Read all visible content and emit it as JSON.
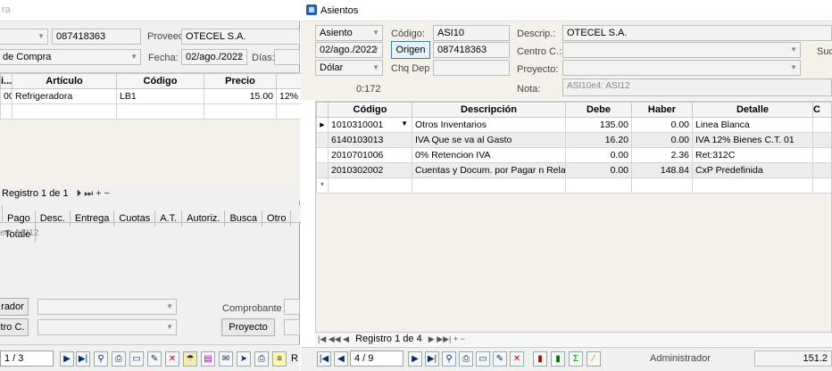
{
  "left": {
    "title_partial": "ra",
    "provider_ruc": "087418363",
    "proveedor_label": "Proveed.",
    "proveedor_value": "OTECEL S.A.",
    "doc_type": "de Compra",
    "fecha_label": "Fecha:",
    "fecha_value": "02/ago./2022",
    "dias_label": "Días:",
    "grid": {
      "headers": [
        "i...",
        "Artículo",
        "Código",
        "Precio",
        ""
      ],
      "rows": [
        [
          "00",
          "Refrigeradora",
          "LB1",
          "15.00",
          "12%"
        ]
      ]
    },
    "registro": "Registro 1 de 1",
    "tabs": [
      "Pago",
      "Desc.",
      "Entrega",
      "Cuotas",
      "A.T.",
      "Autoriz.",
      "Busca",
      "Otro",
      "Totale"
    ],
    "note": "e4: ASI12",
    "btn_rador": "rador",
    "btn_tro": "tro C.",
    "comprobante_label": "Comprobante",
    "proyecto_button": "Proyecto",
    "page_counter": "1 / 3"
  },
  "right": {
    "title": "Asientos",
    "asiento_combo": "Asiento",
    "codigo_label": "Código:",
    "codigo_value": "ASI10",
    "descrip_label": "Descrip.:",
    "descrip_value": "OTECEL S.A.",
    "suc_label": "Suc.",
    "fecha_value": "02/ago./2022",
    "origen_button": "Origen",
    "origen_value": "087418363",
    "centro_label": "Centro C.:",
    "currency": "Dólar",
    "chq_label": "Chq Dep",
    "proyecto_label": "Proyecto:",
    "counter": "0:172",
    "nota_label": "Nota:",
    "nota_value": "ASI10e4: ASI12",
    "grid": {
      "headers": [
        "Código",
        "Descripción",
        "Debe",
        "Haber",
        "Detalle",
        "C"
      ],
      "rows": [
        [
          "1010310001",
          "Otros Inventarios",
          "135.00",
          "0.00",
          "Linea Blanca"
        ],
        [
          "6140103013",
          "IVA Que se va al Gasto",
          "16.20",
          "0.00",
          "IVA 12% Bienes C.T. 01"
        ],
        [
          "2010701006",
          "0% Retencion IVA",
          "0.00",
          "2.36",
          "Ret:312C"
        ],
        [
          "2010302002",
          "Cuentas y Docum. por Pagar n Relacion...",
          "0.00",
          "148.84",
          "CxP Predefinida"
        ]
      ]
    },
    "registro": "Registro 1 de 4",
    "page_counter": "4 / 9",
    "user": "Administrador",
    "total": "151.2"
  },
  "colors": {
    "accent_blue": "#1a5fb4",
    "title_bg": "#ffffff",
    "form_bg": "#f3f1ea"
  }
}
